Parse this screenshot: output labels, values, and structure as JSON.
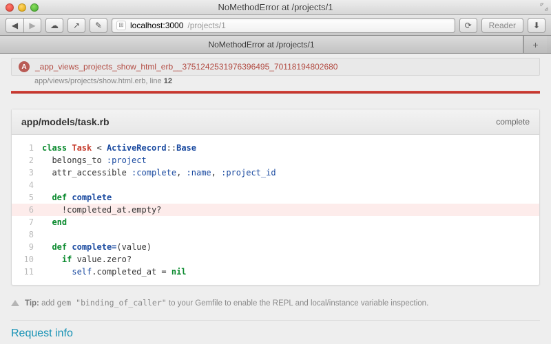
{
  "window": {
    "title": "NoMethodError at /projects/1"
  },
  "toolbar": {
    "back_glyph": "◀",
    "forward_glyph": "▶",
    "cloud_glyph": "☁",
    "share_glyph": "↗",
    "pin_glyph": "✎",
    "reload_glyph": "⟳",
    "download_glyph": "⬇",
    "reader_label": "Reader"
  },
  "address": {
    "host": "localhost:3000",
    "path": "/projects/1",
    "favicon_glyph": "⊞"
  },
  "tab": {
    "title": "NoMethodError at /projects/1",
    "newtab_glyph": "+"
  },
  "trace": {
    "badge": "A",
    "frame_name": "_app_views_projects_show_html_erb__3751242531976396495_70118194802680",
    "file": "app/views/projects/show.html.erb",
    "line_prefix": ", line ",
    "line_number": "12"
  },
  "code_panel": {
    "title": "app/models/task.rb",
    "action": "complete",
    "highlight_line": 6,
    "lines": [
      {
        "n": 1,
        "html": "<span class='kw'>class</span> <span class='cls'>Task</span> &lt; <span class='const'>ActiveRecord</span>::<span class='const'>Base</span>"
      },
      {
        "n": 2,
        "html": "  belongs_to <span class='sym'>:project</span>"
      },
      {
        "n": 3,
        "html": "  attr_accessible <span class='sym'>:complete</span>, <span class='sym'>:name</span>, <span class='sym'>:project_id</span>"
      },
      {
        "n": 4,
        "html": ""
      },
      {
        "n": 5,
        "html": "  <span class='kw'>def</span> <span class='fn'>complete</span>"
      },
      {
        "n": 6,
        "html": "    !completed_at.empty?"
      },
      {
        "n": 7,
        "html": "  <span class='kw'>end</span>"
      },
      {
        "n": 8,
        "html": ""
      },
      {
        "n": 9,
        "html": "  <span class='kw'>def</span> <span class='fn'>complete=</span>(value)"
      },
      {
        "n": 10,
        "html": "    <span class='kw'>if</span> value.zero?"
      },
      {
        "n": 11,
        "html": "      <span class='self'>self</span>.completed_at = <span class='kw'>nil</span>"
      }
    ]
  },
  "tip": {
    "label": "Tip:",
    "text_before": " add ",
    "code": "gem \"binding_of_caller\"",
    "text_after": " to your Gemfile to enable the REPL and local/instance variable inspection."
  },
  "next_section": "Request info"
}
